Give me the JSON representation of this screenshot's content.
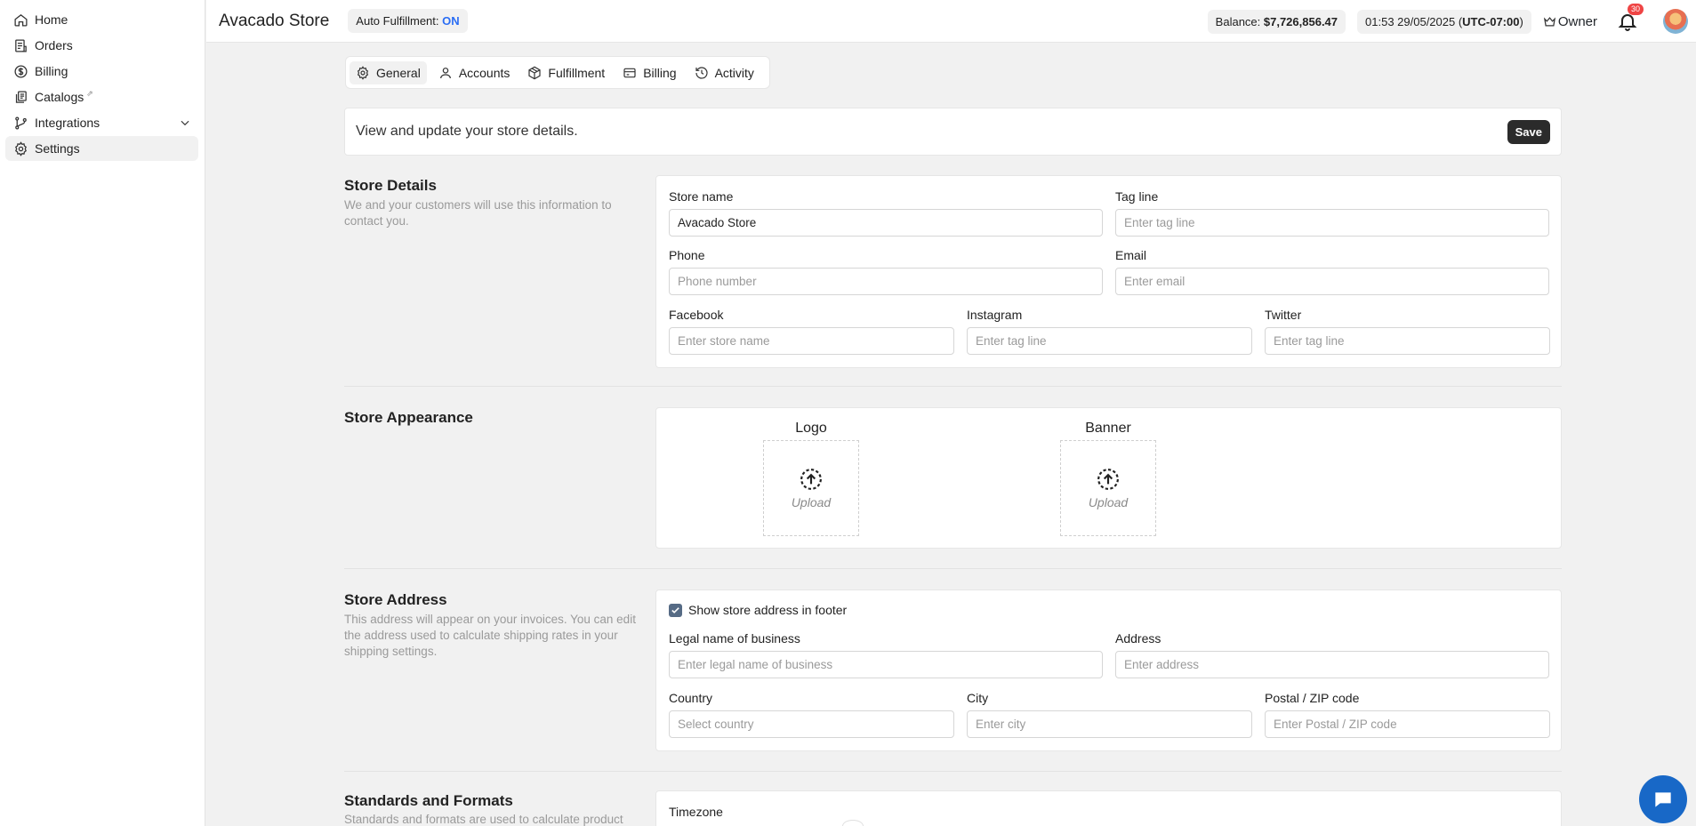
{
  "sidebar": {
    "items": [
      {
        "label": "Home",
        "icon": "home-icon"
      },
      {
        "label": "Orders",
        "icon": "orders-icon"
      },
      {
        "label": "Billing",
        "icon": "dollar-icon"
      },
      {
        "label": "Catalogs",
        "icon": "catalog-icon",
        "external": "⇗"
      },
      {
        "label": "Integrations",
        "icon": "branch-icon"
      },
      {
        "label": "Settings",
        "icon": "gear-icon",
        "active": true
      }
    ]
  },
  "header": {
    "store_name": "Avacado Store",
    "auto_fulfillment_label": "Auto Fulfillment: ",
    "auto_fulfillment_value": "ON",
    "balance_label": "Balance: ",
    "balance_value": "$7,726,856.47",
    "time": "01:53 29/05/2025 (",
    "timezone": "UTC-07:00",
    "time_close": ")",
    "role": "Owner",
    "notifications": "30"
  },
  "tabs": [
    {
      "label": "General",
      "active": true
    },
    {
      "label": "Accounts"
    },
    {
      "label": "Fulfillment"
    },
    {
      "label": "Billing"
    },
    {
      "label": "Activity"
    }
  ],
  "intro": {
    "text": "View and update your store details.",
    "save_label": "Save"
  },
  "store_details": {
    "title": "Store Details",
    "description": "We and your customers will use this information to contact you.",
    "store_name_label": "Store name",
    "store_name_value": "Avacado Store",
    "tagline_label": "Tag line",
    "tagline_placeholder": "Enter tag line",
    "phone_label": "Phone",
    "phone_placeholder": "Phone number",
    "email_label": "Email",
    "email_placeholder": "Enter email",
    "facebook_label": "Facebook",
    "facebook_placeholder": "Enter store name",
    "instagram_label": "Instagram",
    "instagram_placeholder": "Enter tag line",
    "twitter_label": "Twitter",
    "twitter_placeholder": "Enter tag line"
  },
  "store_appearance": {
    "title": "Store Appearance",
    "logo_label": "Logo",
    "banner_label": "Banner",
    "upload_label": "Upload"
  },
  "store_address": {
    "title": "Store Address",
    "description": "This address will appear on your invoices. You can edit the address used to calculate shipping rates in your shipping settings.",
    "show_footer_label": "Show store address in footer",
    "show_footer_checked": true,
    "legal_name_label": "Legal name of business",
    "legal_name_placeholder": "Enter legal name of business",
    "address_label": "Address",
    "address_placeholder": "Enter address",
    "country_label": "Country",
    "country_placeholder": "Select country",
    "city_label": "City",
    "city_placeholder": "Enter city",
    "postal_label": "Postal / ZIP code",
    "postal_placeholder": "Enter Postal / ZIP code"
  },
  "standards": {
    "title": "Standards and Formats",
    "description": "Standards and formats are used to calculate product",
    "timezone_label": "Timezone"
  },
  "colors": {
    "accent": "#2a6df4",
    "dark_button": "#2b2b2b",
    "checkbox": "#566b85",
    "chat": "#1868c7",
    "badge": "#ef4444"
  }
}
